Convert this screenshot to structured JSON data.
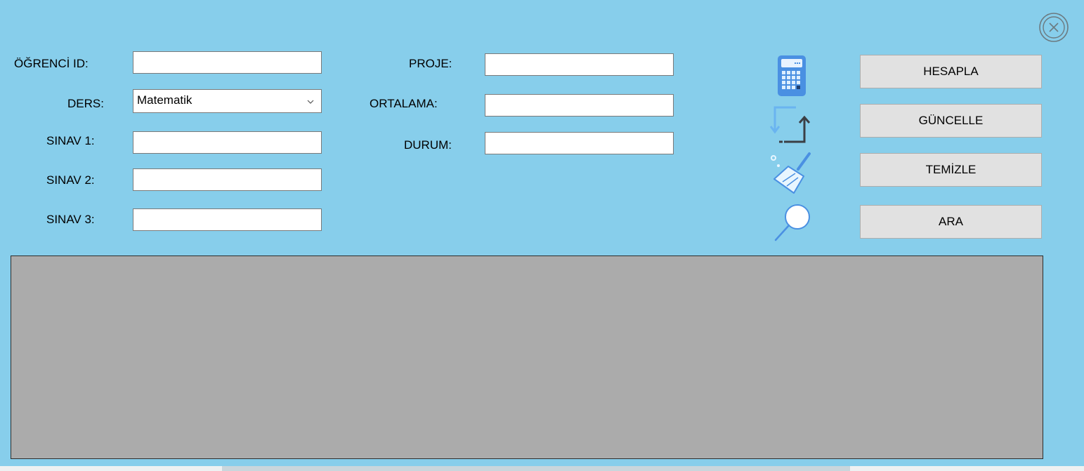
{
  "form": {
    "ogrenci_id_label": "ÖĞRENCİ ID:",
    "ogrenci_id_value": "",
    "ders_label": "DERS:",
    "ders_value": "Matematik",
    "sinav1_label": "SINAV 1:",
    "sinav1_value": "",
    "sinav2_label": "SINAV 2:",
    "sinav2_value": "",
    "sinav3_label": "SINAV 3:",
    "sinav3_value": "",
    "proje_label": "PROJE:",
    "proje_value": "",
    "ortalama_label": "ORTALAMA:",
    "ortalama_value": "",
    "durum_label": "DURUM:",
    "durum_value": ""
  },
  "actions": {
    "hesapla": "HESAPLA",
    "guncelle": "GÜNCELLE",
    "temizle": "TEMİZLE",
    "ara": "ARA"
  },
  "icons": {
    "close": "close-circle-icon",
    "calculator": "calculator-icon",
    "update": "update-arrows-icon",
    "clean": "broom-icon",
    "search": "search-icon"
  },
  "colors": {
    "background": "#87ceeb",
    "grid": "#ababab",
    "button": "#e1e1e1"
  }
}
